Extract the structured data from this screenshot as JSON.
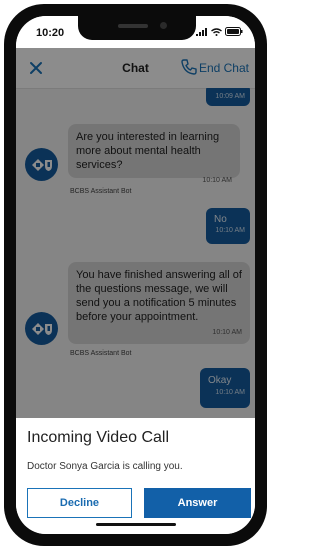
{
  "status_bar": {
    "time": "10:20"
  },
  "header": {
    "title": "Chat",
    "end_chat_label": "End Chat"
  },
  "messages": [
    {
      "direction": "outgoing",
      "text": "",
      "time": "10:09 AM"
    },
    {
      "direction": "incoming",
      "text": "Are you interested in learning more about mental health services?",
      "time": "10:10 AM",
      "sender": "BCBS Assistant Bot"
    },
    {
      "direction": "outgoing",
      "text": "No",
      "time": "10:10 AM"
    },
    {
      "direction": "incoming",
      "text": "You have finished answering all of the questions message, we will send you a notification 5 minutes before your appointment.",
      "time": "10:10 AM",
      "sender": "BCBS Assistant Bot"
    },
    {
      "direction": "outgoing",
      "text": "Okay",
      "time": "10:10 AM"
    }
  ],
  "incoming_call": {
    "title": "Incoming Video Call",
    "subtitle": "Doctor Sonya Garcia is calling you.",
    "decline_label": "Decline",
    "answer_label": "Answer"
  },
  "colors": {
    "brand_blue": "#1260a8",
    "link_blue": "#1a73b8",
    "bubble_in": "#d6d6d6"
  },
  "icons": [
    "close-icon",
    "phone-icon",
    "signal-icon",
    "wifi-icon",
    "battery-icon",
    "bcbs-logo-icon"
  ]
}
